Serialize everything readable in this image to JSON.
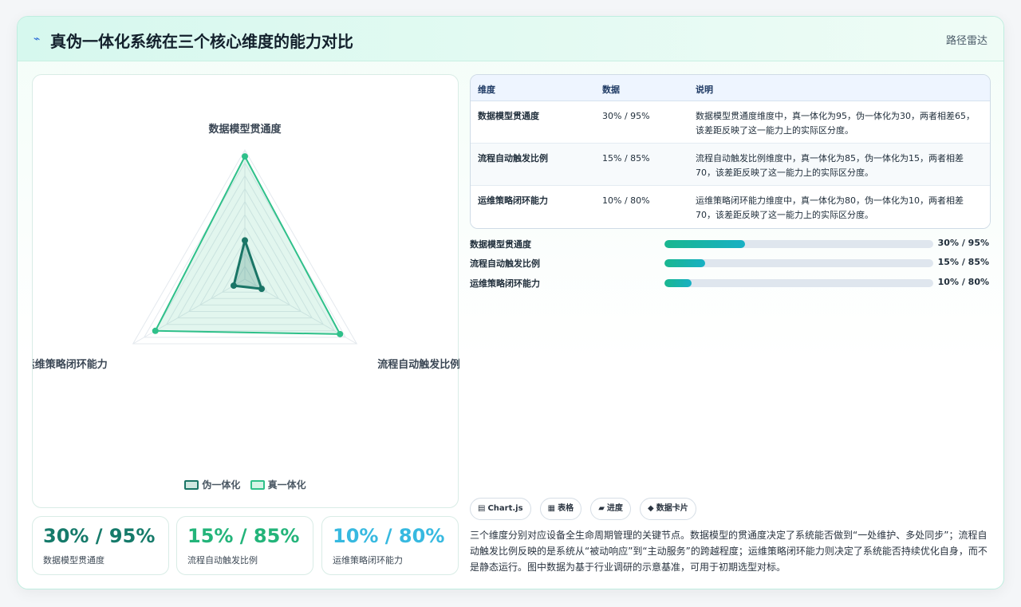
{
  "header": {
    "icon": "pulse-icon",
    "icon_glyph": "⌁",
    "title": "真伪一体化系统在三个核心维度的能力对比",
    "right_label": "路径雷达"
  },
  "colors": {
    "fake": "#1a7566",
    "true": "#2fc08a",
    "stat1": "#157a6a",
    "stat2": "#23b47a",
    "stat3": "#37b9e0"
  },
  "chart_data": {
    "type": "radar",
    "axes": [
      "数据模型贯通度",
      "流程自动触发比例",
      "运维策略闭环能力"
    ],
    "range": [
      0,
      100
    ],
    "series": [
      {
        "name": "伪一体化",
        "values": [
          30,
          15,
          10
        ]
      },
      {
        "name": "真一体化",
        "values": [
          95,
          85,
          80
        ]
      }
    ],
    "legend": "bottom"
  },
  "legend": [
    {
      "name": "伪一体化"
    },
    {
      "name": "真一体化"
    }
  ],
  "stats": [
    {
      "value": "30% / 95%",
      "label": "数据模型贯通度"
    },
    {
      "value": "15% / 85%",
      "label": "流程自动触发比例"
    },
    {
      "value": "10% / 80%",
      "label": "运维策略闭环能力"
    }
  ],
  "table": {
    "headers": [
      "维度",
      "数据",
      "说明"
    ],
    "rows": [
      {
        "name": "数据模型贯通度",
        "data": "30% / 95%",
        "desc": "数据模型贯通度维度中，真一体化为95，伪一体化为30，两者相差65，该差距反映了这一能力上的实际区分度。"
      },
      {
        "name": "流程自动触发比例",
        "data": "15% / 85%",
        "desc": "流程自动触发比例维度中，真一体化为85，伪一体化为15，两者相差70，该差距反映了这一能力上的实际区分度。"
      },
      {
        "name": "运维策略闭环能力",
        "data": "10% / 80%",
        "desc": "运维策略闭环能力维度中，真一体化为80，伪一体化为10，两者相差70，该差距反映了这一能力上的实际区分度。"
      }
    ]
  },
  "bars": [
    {
      "label": "数据模型贯通度",
      "fill": 0.3,
      "value": "30% / 95%"
    },
    {
      "label": "流程自动触发比例",
      "fill": 0.15,
      "value": "15% / 85%"
    },
    {
      "label": "运维策略闭环能力",
      "fill": 0.1,
      "value": "10% / 80%"
    }
  ],
  "tags": [
    {
      "icon": "table-icon",
      "glyph": "▤",
      "label": "Chart.js"
    },
    {
      "icon": "grid-icon",
      "glyph": "▦",
      "label": "表格"
    },
    {
      "icon": "progress-icon",
      "glyph": "▰",
      "label": "进度"
    },
    {
      "icon": "diamond-icon",
      "glyph": "◆",
      "label": "数据卡片"
    }
  ],
  "note": "三个维度分别对应设备全生命周期管理的关键节点。数据模型的贯通度决定了系统能否做到“一处维护、多处同步”；流程自动触发比例反映的是系统从“被动响应”到“主动服务”的跨越程度；运维策略闭环能力则决定了系统能否持续优化自身，而不是静态运行。图中数据为基于行业调研的示意基准，可用于初期选型对标。"
}
